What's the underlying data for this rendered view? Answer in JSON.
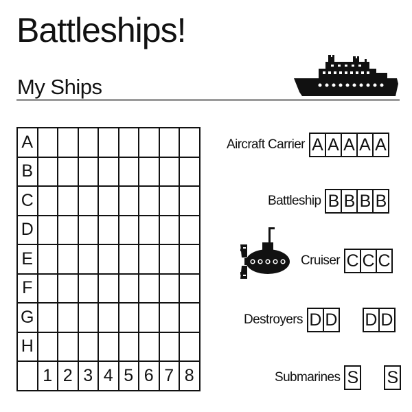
{
  "header": {
    "title": "Battleships!",
    "subtitle": "My Ships"
  },
  "board": {
    "row_labels": [
      "A",
      "B",
      "C",
      "D",
      "E",
      "F",
      "G",
      "H"
    ],
    "column_labels": [
      "1",
      "2",
      "3",
      "4",
      "5",
      "6",
      "7",
      "8"
    ]
  },
  "fleet": {
    "aircraft_carrier": {
      "label": "Aircraft Carrier",
      "cells": [
        "A",
        "A",
        "A",
        "A",
        "A"
      ]
    },
    "battleship": {
      "label": "Battleship",
      "cells": [
        "B",
        "B",
        "B",
        "B"
      ]
    },
    "cruiser": {
      "label": "Cruiser",
      "cells": [
        "C",
        "C",
        "C"
      ]
    },
    "destroyers": {
      "label": "Destroyers",
      "ship1": [
        "D",
        "D"
      ],
      "ship2": [
        "D",
        "D"
      ]
    },
    "submarines": {
      "label": "Submarines",
      "ship1": [
        "S"
      ],
      "ship2": [
        "S"
      ]
    }
  },
  "icons": {
    "ship": "ship-icon",
    "submarine": "submarine-icon"
  },
  "colors": {
    "ink": "#111111",
    "rule": "#9a9a9a",
    "background": "#ffffff"
  }
}
